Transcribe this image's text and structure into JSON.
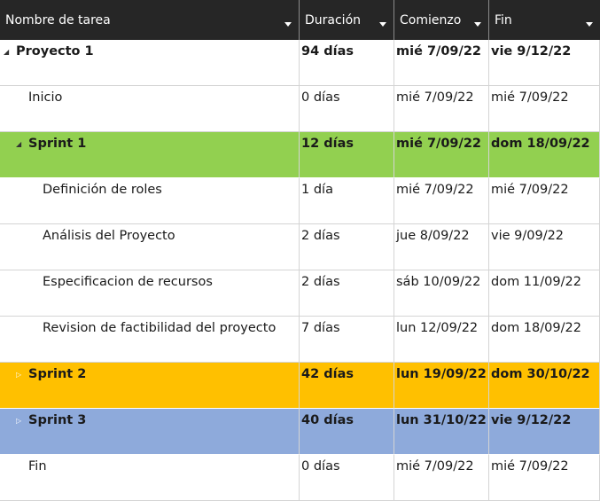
{
  "columns": {
    "name": "Nombre de tarea",
    "duration": "Duración",
    "start": "Comienzo",
    "end": "Fin"
  },
  "rows": [
    {
      "name": "Proyecto 1",
      "duration": "94 días",
      "start": "mié 7/09/22",
      "end": "vie 9/12/22"
    },
    {
      "name": "Inicio",
      "duration": "0 días",
      "start": "mié 7/09/22",
      "end": "mié 7/09/22"
    },
    {
      "name": "Sprint 1",
      "duration": "12 días",
      "start": "mié 7/09/22",
      "end": "dom 18/09/22"
    },
    {
      "name": "Definición de roles",
      "duration": "1 día",
      "start": "mié 7/09/22",
      "end": "mié 7/09/22"
    },
    {
      "name": "Análisis del Proyecto",
      "duration": "2 días",
      "start": "jue 8/09/22",
      "end": "vie 9/09/22"
    },
    {
      "name": "Especificacion de recursos",
      "duration": "2 días",
      "start": "sáb 10/09/22",
      "end": "dom 11/09/22"
    },
    {
      "name": "Revision de factibilidad del proyecto",
      "duration": "7 días",
      "start": "lun 12/09/22",
      "end": "dom 18/09/22"
    },
    {
      "name": "Sprint 2",
      "duration": "42 días",
      "start": "lun 19/09/22",
      "end": "dom 30/10/22"
    },
    {
      "name": "Sprint 3",
      "duration": "40 días",
      "start": "lun 31/10/22",
      "end": "vie 9/12/22"
    },
    {
      "name": "Fin",
      "duration": "0 días",
      "start": "mié 7/09/22",
      "end": "mié 7/09/22"
    }
  ],
  "colors": {
    "header_bg": "#262626",
    "sprint1": "#92d050",
    "sprint2": "#ffc000",
    "sprint3": "#8eaadb"
  },
  "icons": {
    "expanded": "collapse-triangle-icon",
    "collapsed": "expand-triangle-icon",
    "filter": "filter-dropdown-icon"
  }
}
